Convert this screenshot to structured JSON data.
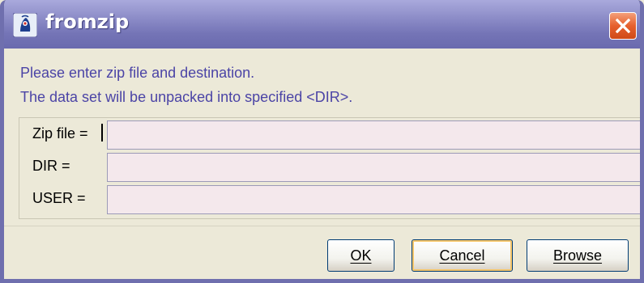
{
  "window": {
    "title": "fromzip",
    "app_icon": "java-duke-icon",
    "close_icon": "close-icon"
  },
  "message": {
    "line1": "Please enter zip file and destination.",
    "line2": "The data set will be unpacked into specified <DIR>."
  },
  "form": {
    "zip_file": {
      "label": "Zip file =",
      "value": ""
    },
    "dir": {
      "label": "DIR =",
      "value": ""
    },
    "user": {
      "label": "USER =",
      "value": ""
    }
  },
  "buttons": {
    "ok": "OK",
    "cancel": "Cancel",
    "browse": "Browse"
  },
  "colors": {
    "titlebar": "#7b7bbf",
    "message_text": "#4b44a6",
    "input_background": "#f4e8ec",
    "close_button": "#e6602e"
  }
}
